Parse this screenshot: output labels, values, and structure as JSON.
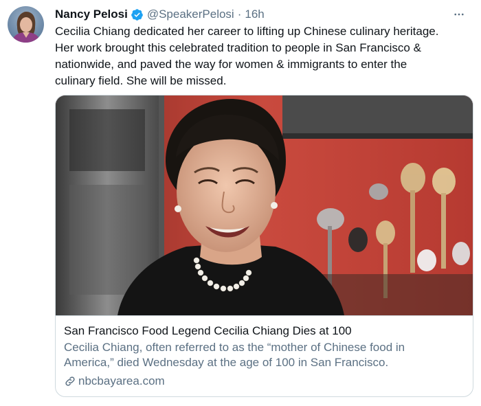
{
  "tweet": {
    "author_name": "Nancy Pelosi",
    "handle": "@SpeakerPelosi",
    "separator": "·",
    "time": "16h",
    "text": "Cecilia Chiang dedicated her career to lifting up Chinese culinary heritage.\nHer work brought this celebrated tradition to people in San Francisco &\nnationwide, and paved the way for women & immigrants to enter the\nculinary field. She will be missed.",
    "icons": {
      "verified": "verified-badge-icon",
      "more": "more-options-icon",
      "link": "link-icon"
    },
    "colors": {
      "verified": "#1da1f2",
      "secondary_text": "#5b7083",
      "border": "#cfd9de"
    }
  },
  "card": {
    "title": "San Francisco Food Legend Cecilia Chiang Dies at 100",
    "description": "Cecilia Chiang, often referred to as the “mother of Chinese food in\nAmerica,” died Wednesday at the age of 100 in San Francisco.",
    "domain": "nbcbayarea.com"
  }
}
